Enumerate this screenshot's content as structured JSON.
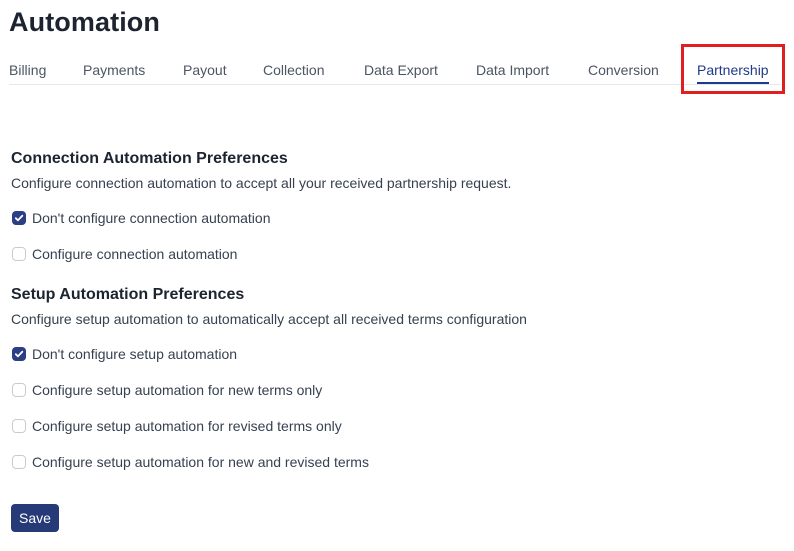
{
  "page": {
    "title": "Automation"
  },
  "tabs": [
    {
      "label": "Billing",
      "active": false
    },
    {
      "label": "Payments",
      "active": false
    },
    {
      "label": "Payout",
      "active": false
    },
    {
      "label": "Collection",
      "active": false
    },
    {
      "label": "Data Export",
      "active": false
    },
    {
      "label": "Data Import",
      "active": false
    },
    {
      "label": "Conversion",
      "active": false
    },
    {
      "label": "Partnership",
      "active": true
    }
  ],
  "connection": {
    "title": "Connection Automation Preferences",
    "description": "Configure connection automation to accept all your received partnership request.",
    "options": [
      {
        "label": "Don't configure connection automation",
        "checked": true
      },
      {
        "label": "Configure connection automation",
        "checked": false
      }
    ]
  },
  "setup": {
    "title": "Setup Automation Preferences",
    "description": "Configure setup automation to automatically accept all received terms configuration",
    "options": [
      {
        "label": "Don't configure setup automation",
        "checked": true
      },
      {
        "label": "Configure setup automation for new terms only",
        "checked": false
      },
      {
        "label": "Configure setup automation for revised terms only",
        "checked": false
      },
      {
        "label": "Configure setup automation for new and revised terms",
        "checked": false
      }
    ]
  },
  "actions": {
    "save_label": "Save"
  },
  "colors": {
    "accent": "#263a78",
    "highlight": "#e02020"
  },
  "icons": {
    "checkbox_checked": "checkmark-icon"
  }
}
